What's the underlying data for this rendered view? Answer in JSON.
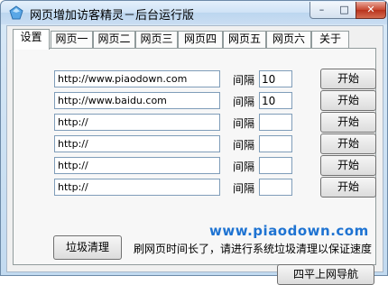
{
  "window": {
    "title": "网页增加访客精灵－后台运行版",
    "minimize_label": "–",
    "maximize_label": "□",
    "close_label": "✕"
  },
  "tabs": [
    {
      "label": "设置",
      "active": true
    },
    {
      "label": "网页一"
    },
    {
      "label": "网页二"
    },
    {
      "label": "网页三"
    },
    {
      "label": "网页四"
    },
    {
      "label": "网页五"
    },
    {
      "label": "网页六"
    },
    {
      "label": "关于"
    }
  ],
  "rows": [
    {
      "url": "http://www.piaodown.com",
      "gap_label": "间隔",
      "interval": "10",
      "start_label": "开始"
    },
    {
      "url": "http://www.baidu.com",
      "gap_label": "间隔",
      "interval": "10",
      "start_label": "开始"
    },
    {
      "url": "http://",
      "gap_label": "间隔",
      "interval": "",
      "start_label": "开始"
    },
    {
      "url": "http://",
      "gap_label": "间隔",
      "interval": "",
      "start_label": "开始"
    },
    {
      "url": "http://",
      "gap_label": "间隔",
      "interval": "",
      "start_label": "开始"
    },
    {
      "url": "http://",
      "gap_label": "间隔",
      "interval": "",
      "start_label": "开始"
    }
  ],
  "clean_button": "垃圾清理",
  "hint": "刷网页时间长了，请进行系统垃圾清理以保证速度",
  "watermark": "www.piaodown.com",
  "nav_button": "四平上网导航"
}
